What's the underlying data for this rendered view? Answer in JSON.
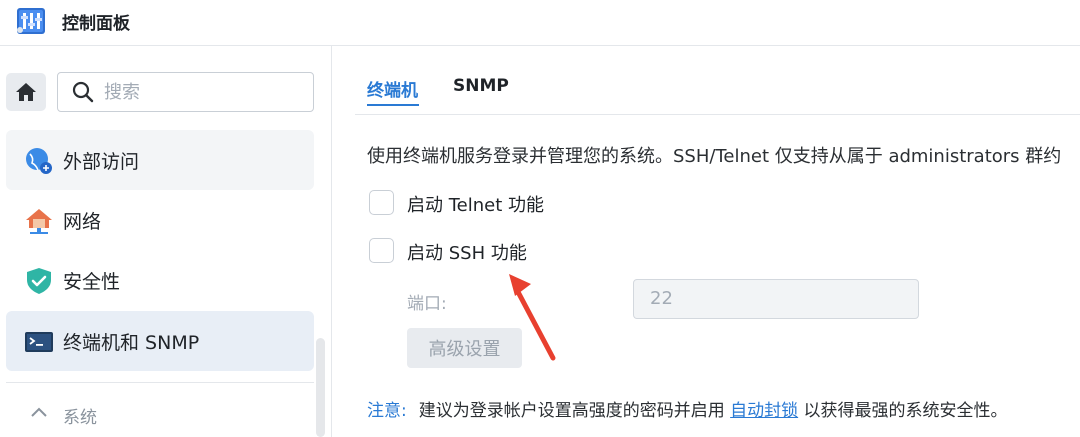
{
  "window": {
    "title": "控制面板",
    "app_icon": "control-panel-icon"
  },
  "sidebar": {
    "home_icon": "home-icon",
    "search": {
      "placeholder": "搜索",
      "value": ""
    },
    "items": [
      {
        "label": "外部访问",
        "icon": "globe-icon"
      },
      {
        "label": "网络",
        "icon": "network-house-icon"
      },
      {
        "label": "安全性",
        "icon": "shield-check-icon"
      },
      {
        "label": "终端机和 SNMP",
        "icon": "terminal-icon",
        "selected": true
      }
    ],
    "section": {
      "label": "系统",
      "icon": "chevron-up-icon"
    }
  },
  "main": {
    "tabs": [
      {
        "label": "终端机",
        "active": true
      },
      {
        "label": "SNMP",
        "active": false
      }
    ],
    "description": "使用终端机服务登录并管理您的系统。SSH/Telnet 仅支持从属于 administrators 群约",
    "telnet_checkbox": {
      "label": "启动 Telnet 功能",
      "checked": false
    },
    "ssh_checkbox": {
      "label": "启动 SSH 功能",
      "checked": false
    },
    "port": {
      "label": "端口:",
      "value": "22"
    },
    "advanced_button": "高级设置",
    "note": {
      "prefix": "注意:",
      "text_before": "建议为登录帐户设置高强度的密码并启用",
      "link": "自动封锁",
      "text_after": "以获得最强的系统安全性。"
    }
  },
  "colors": {
    "accent": "#2a7ad4",
    "annotation_arrow": "#e8402f"
  }
}
